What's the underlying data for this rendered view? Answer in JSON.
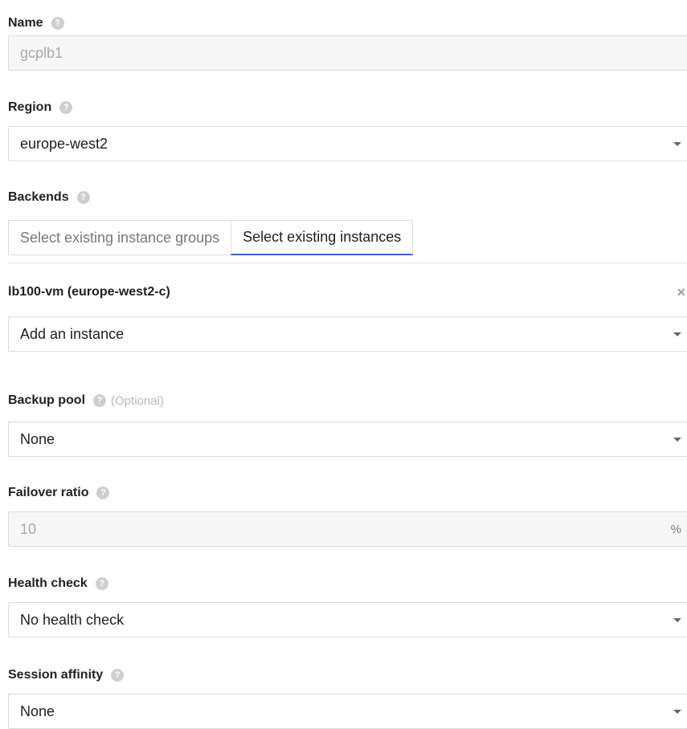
{
  "name": {
    "label": "Name",
    "value": "gcplb1"
  },
  "region": {
    "label": "Region",
    "value": "europe-west2"
  },
  "backends": {
    "label": "Backends",
    "tabs": [
      {
        "label": "Select existing instance groups"
      },
      {
        "label": "Select existing instances"
      }
    ],
    "instances": [
      {
        "name": "lb100-vm (europe-west2-c)",
        "remove_glyph": "×"
      }
    ],
    "add_instance": {
      "value": "Add an instance"
    }
  },
  "backup_pool": {
    "label": "Backup pool",
    "optional": "(Optional)",
    "value": "None"
  },
  "failover_ratio": {
    "label": "Failover ratio",
    "value": "10",
    "suffix": "%"
  },
  "health_check": {
    "label": "Health check",
    "value": "No health check"
  },
  "session_affinity": {
    "label": "Session affinity",
    "value": "None"
  },
  "help_glyph": "?",
  "colors": {
    "accent": "#3367d6",
    "help_icon": "#cfcfcf",
    "border": "#dcdcdc"
  }
}
